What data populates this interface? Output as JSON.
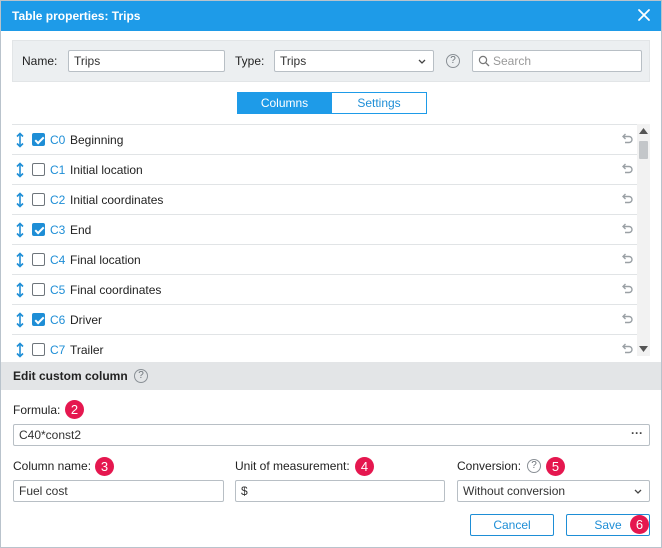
{
  "window": {
    "title": "Table properties: Trips"
  },
  "filter": {
    "name_label": "Name:",
    "name_value": "Trips",
    "type_label": "Type:",
    "type_value": "Trips",
    "search_placeholder": "Search"
  },
  "tabs": [
    {
      "label": "Columns",
      "active": true
    },
    {
      "label": "Settings",
      "active": false
    }
  ],
  "columns": [
    {
      "code": "C0",
      "name": "Beginning",
      "checked": true
    },
    {
      "code": "C1",
      "name": "Initial location",
      "checked": false
    },
    {
      "code": "C2",
      "name": "Initial coordinates",
      "checked": false
    },
    {
      "code": "C3",
      "name": "End",
      "checked": true
    },
    {
      "code": "C4",
      "name": "Final location",
      "checked": false
    },
    {
      "code": "C5",
      "name": "Final coordinates",
      "checked": false
    },
    {
      "code": "C6",
      "name": "Driver",
      "checked": true
    },
    {
      "code": "C7",
      "name": "Trailer",
      "checked": false
    }
  ],
  "edit": {
    "title": "Edit custom column",
    "formula_label": "Formula:",
    "formula_value": "C40*const2",
    "formula_more": "···",
    "column_name_label": "Column name:",
    "column_name_value": "Fuel cost",
    "unit_label": "Unit of measurement:",
    "unit_value": "$",
    "conversion_label": "Conversion:",
    "conversion_value": "Without conversion"
  },
  "badges": {
    "formula": "2",
    "column_name": "3",
    "unit": "4",
    "conversion": "5",
    "save": "6"
  },
  "buttons": {
    "cancel": "Cancel",
    "save": "Save"
  },
  "colors": {
    "accent": "#1e9be8",
    "badge": "#e5174f"
  }
}
